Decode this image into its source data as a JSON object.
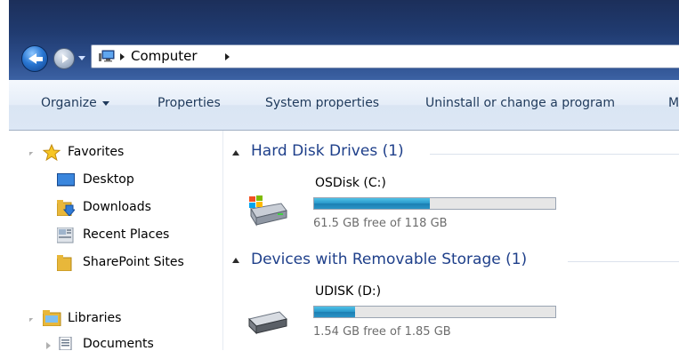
{
  "address": {
    "path": "Computer"
  },
  "toolbar": {
    "organize": "Organize",
    "properties": "Properties",
    "system_properties": "System properties",
    "uninstall": "Uninstall or change a program",
    "more": "M"
  },
  "nav": {
    "favorites": "Favorites",
    "desktop": "Desktop",
    "downloads": "Downloads",
    "recent_places": "Recent Places",
    "sharepoint": "SharePoint Sites",
    "libraries": "Libraries",
    "documents": "Documents"
  },
  "groups": {
    "hard_disk": "Hard Disk Drives (1)",
    "removable": "Devices with Removable Storage (1)"
  },
  "drives": [
    {
      "name": "OSDisk (C:)",
      "free_text": "61.5 GB free of 118 GB",
      "used_fraction": 0.48
    },
    {
      "name": "UDISK (D:)",
      "free_text": "1.54 GB free of 1.85 GB",
      "used_fraction": 0.17
    }
  ],
  "colors": {
    "accent": "#1e3f8a",
    "bar_fill": "#2896c9"
  }
}
